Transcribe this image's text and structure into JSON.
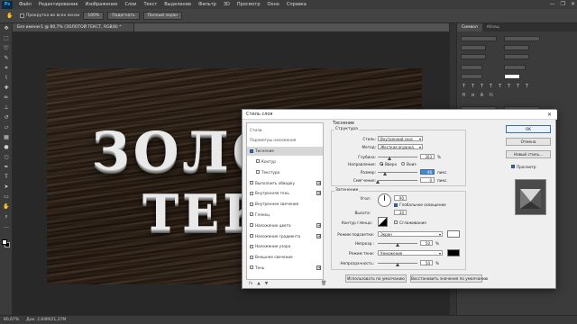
{
  "app": {
    "logo": "Ps"
  },
  "menubar": {
    "items": [
      "Файл",
      "Редактирование",
      "Изображение",
      "Слои",
      "Текст",
      "Выделение",
      "Фильтр",
      "3D",
      "Просмотр",
      "Окно",
      "Справка"
    ]
  },
  "window_controls": {
    "minimize": "—",
    "maximize": "❐",
    "close": "✕"
  },
  "options_bar": {
    "scroll_all": "Прокрутка во всех окнах",
    "zoom": "100%",
    "fit_screen": "Подогнать",
    "full_screen": "Полный экран"
  },
  "document": {
    "tab_title": "Без имени-1 @ 80,7% (ЗОЛОТОЙ ТЕКСТ, RGB/8) *",
    "text_line1": "ЗОЛОТОЙ",
    "text_line2": "ТЕКСТ"
  },
  "right_panel": {
    "tabs": [
      "Символ",
      "Абзац"
    ]
  },
  "status_bar": {
    "zoom": "80,67%",
    "doc_info": "Док: 2,64M/21,37M"
  },
  "dialog": {
    "title": "Стиль слоя",
    "close": "✕",
    "styles_list": [
      {
        "label": "Стили",
        "type": "header"
      },
      {
        "label": "Параметры наложения",
        "type": "header"
      },
      {
        "label": "Тиснение",
        "checked": true,
        "selected": true
      },
      {
        "label": "Контур",
        "checked": false,
        "indent": true
      },
      {
        "label": "Текстура",
        "checked": false,
        "indent": true
      },
      {
        "label": "Выполнить обводку",
        "checked": false,
        "plus": true
      },
      {
        "label": "Внутренняя тень",
        "checked": false,
        "plus": true
      },
      {
        "label": "Внутреннее свечение",
        "checked": false
      },
      {
        "label": "Глянец",
        "checked": false
      },
      {
        "label": "Наложение цвета",
        "checked": false,
        "plus": true
      },
      {
        "label": "Наложение градиента",
        "checked": false,
        "plus": true
      },
      {
        "label": "Наложение узора",
        "checked": false
      },
      {
        "label": "Внешнее свечение",
        "checked": false
      },
      {
        "label": "Тень",
        "checked": false,
        "plus": true
      }
    ],
    "styles_footer": {
      "fx": "fx",
      "up": "▲",
      "down": "▼",
      "trash": "🗑"
    },
    "section_title": "Тиснение",
    "structure": {
      "title": "Структура",
      "style_label": "Стиль:",
      "style_value": "Внутренний скос",
      "technique_label": "Метод:",
      "technique_value": "Жесткая огранка",
      "depth_label": "Глубина:",
      "depth_value": "303",
      "depth_unit": "%",
      "depth_fraction": 0.3,
      "direction_label": "Направление:",
      "dir_up": "Вверх",
      "dir_down": "Вниз",
      "size_label": "Размер:",
      "size_value": "46",
      "size_unit": "пикс.",
      "size_fraction": 0.18,
      "soften_label": "Смягчение:",
      "soften_value": "0",
      "soften_unit": "пикс.",
      "soften_fraction": 0.0
    },
    "shading": {
      "title": "Затенение",
      "angle_label": "Угол:",
      "angle_value": "90",
      "global_light": "Глобальное освещение",
      "altitude_label": "Высота:",
      "altitude_value": "30",
      "gloss_contour_label": "Контур глянца:",
      "antialias": "Сглаживание",
      "highlight_mode_label": "Режим подсветки:",
      "highlight_mode_value": "Экран",
      "highlight_opacity_label": "Непрозр.:",
      "highlight_opacity_value": "50",
      "highlight_opacity_unit": "%",
      "highlight_fraction": 0.5,
      "shadow_mode_label": "Режим тени:",
      "shadow_mode_value": "Умножение",
      "shadow_opacity_label": "Непрозрачность:",
      "shadow_opacity_value": "50",
      "shadow_opacity_unit": "%",
      "shadow_fraction": 0.5,
      "highlight_color": "#ffffff",
      "shadow_color": "#000000"
    },
    "buttons": {
      "make_default": "Использовать по умолчанию",
      "reset_default": "Восстановить значения по умолчанию",
      "ok": "OK",
      "cancel": "Отмена",
      "new_style": "Новый стиль...",
      "preview": "Просмотр"
    }
  }
}
